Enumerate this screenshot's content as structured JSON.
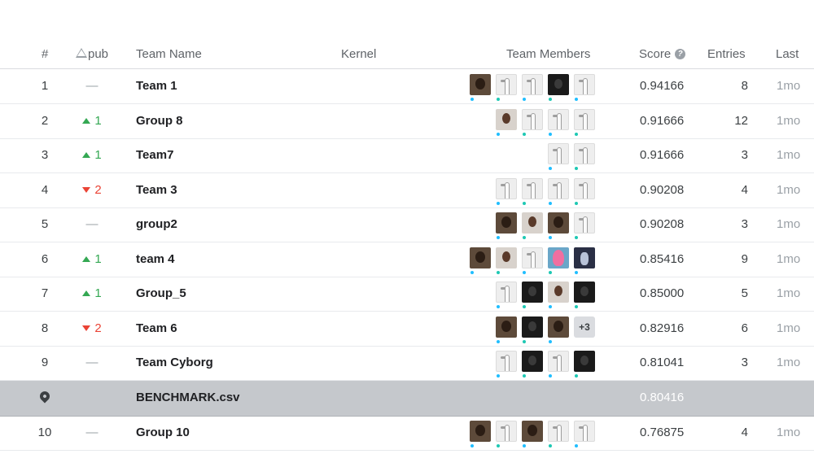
{
  "header": {
    "rank": "#",
    "delta": "pub",
    "team_name": "Team Name",
    "kernel": "Kernel",
    "team_members": "Team Members",
    "score": "Score",
    "entries": "Entries",
    "last": "Last"
  },
  "benchmark": {
    "name": "BENCHMARK.csv",
    "score": "0.80416",
    "icon": "map-pin-icon"
  },
  "rows": [
    {
      "rank": "1",
      "delta": "—",
      "dir": "none",
      "team": "Team 1",
      "score": "0.94166",
      "entries": "8",
      "last": "1mo",
      "members": [
        {
          "t": "photo"
        },
        {
          "t": "goose"
        },
        {
          "t": "goose"
        },
        {
          "t": "dark"
        },
        {
          "t": "goose"
        }
      ]
    },
    {
      "rank": "2",
      "delta": "1",
      "dir": "up",
      "team": "Group 8",
      "score": "0.91666",
      "entries": "12",
      "last": "1mo",
      "members": [
        {
          "t": "light"
        },
        {
          "t": "goose"
        },
        {
          "t": "goose"
        },
        {
          "t": "goose"
        }
      ]
    },
    {
      "rank": "3",
      "delta": "1",
      "dir": "up",
      "team": "Team7",
      "score": "0.91666",
      "entries": "3",
      "last": "1mo",
      "members": [
        {
          "t": "goose"
        },
        {
          "t": "goose"
        }
      ]
    },
    {
      "rank": "4",
      "delta": "2",
      "dir": "down",
      "team": "Team 3",
      "score": "0.90208",
      "entries": "4",
      "last": "1mo",
      "members": [
        {
          "t": "goose"
        },
        {
          "t": "goose"
        },
        {
          "t": "goose"
        },
        {
          "t": "goose"
        }
      ]
    },
    {
      "rank": "5",
      "delta": "—",
      "dir": "none",
      "team": "group2",
      "score": "0.90208",
      "entries": "3",
      "last": "1mo",
      "members": [
        {
          "t": "photo"
        },
        {
          "t": "light"
        },
        {
          "t": "photo"
        },
        {
          "t": "goose"
        }
      ]
    },
    {
      "rank": "6",
      "delta": "1",
      "dir": "up",
      "team": "team 4",
      "score": "0.85416",
      "entries": "9",
      "last": "1mo",
      "members": [
        {
          "t": "photo"
        },
        {
          "t": "light"
        },
        {
          "t": "goose"
        },
        {
          "t": "pink"
        },
        {
          "t": "navy"
        }
      ]
    },
    {
      "rank": "7",
      "delta": "1",
      "dir": "up",
      "team": "Group_5",
      "score": "0.85000",
      "entries": "5",
      "last": "1mo",
      "members": [
        {
          "t": "goose"
        },
        {
          "t": "dark"
        },
        {
          "t": "light"
        },
        {
          "t": "dark"
        }
      ]
    },
    {
      "rank": "8",
      "delta": "2",
      "dir": "down",
      "team": "Team 6",
      "score": "0.82916",
      "entries": "6",
      "last": "1mo",
      "members": [
        {
          "t": "photo"
        },
        {
          "t": "dark"
        },
        {
          "t": "photo"
        },
        {
          "t": "more",
          "label": "+3"
        }
      ]
    },
    {
      "rank": "9",
      "delta": "—",
      "dir": "none",
      "team": "Team Cyborg",
      "score": "0.81041",
      "entries": "3",
      "last": "1mo",
      "members": [
        {
          "t": "goose"
        },
        {
          "t": "dark"
        },
        {
          "t": "goose"
        },
        {
          "t": "dark"
        }
      ]
    },
    {
      "rank": "10",
      "delta": "—",
      "dir": "none",
      "team": "Group 10",
      "score": "0.76875",
      "entries": "4",
      "last": "1mo",
      "members": [
        {
          "t": "photo"
        },
        {
          "t": "goose"
        },
        {
          "t": "photo"
        },
        {
          "t": "goose"
        },
        {
          "t": "goose"
        }
      ]
    }
  ],
  "colors": {
    "up": "#34a853",
    "down": "#ea4335",
    "benchmark_bg": "#c5c8cc",
    "member_dot": "#20beff"
  }
}
